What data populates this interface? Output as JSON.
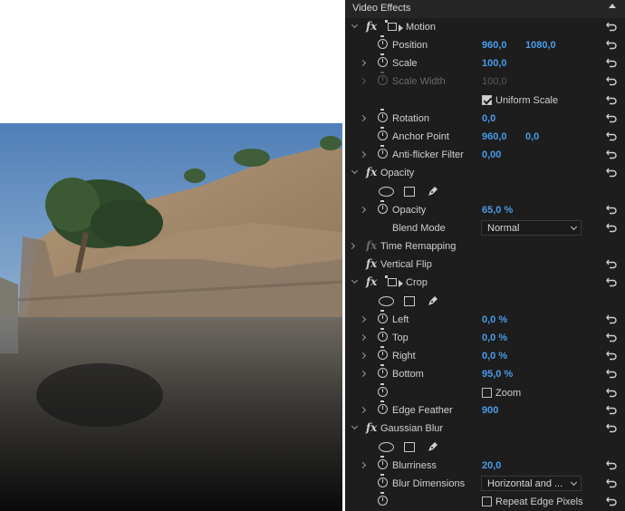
{
  "panel": {
    "title": "Video Effects",
    "motion": {
      "name": "Motion",
      "position": {
        "label": "Position",
        "x": "960,0",
        "y": "1080,0"
      },
      "scale": {
        "label": "Scale",
        "value": "100,0"
      },
      "scale_width": {
        "label": "Scale Width",
        "value": "100,0"
      },
      "uniform_scale": {
        "label": "Uniform Scale",
        "checked": true
      },
      "rotation": {
        "label": "Rotation",
        "value": "0,0"
      },
      "anchor_point": {
        "label": "Anchor Point",
        "x": "960,0",
        "y": "0,0"
      },
      "anti_flicker": {
        "label": "Anti-flicker Filter",
        "value": "0,00"
      }
    },
    "opacity": {
      "name": "Opacity",
      "opacity": {
        "label": "Opacity",
        "value": "65,0 %"
      },
      "blend_mode": {
        "label": "Blend Mode",
        "value": "Normal"
      }
    },
    "time_remapping": {
      "name": "Time Remapping"
    },
    "vertical_flip": {
      "name": "Vertical Flip"
    },
    "crop": {
      "name": "Crop",
      "left": {
        "label": "Left",
        "value": "0,0 %"
      },
      "top": {
        "label": "Top",
        "value": "0,0 %"
      },
      "right": {
        "label": "Right",
        "value": "0,0 %"
      },
      "bottom": {
        "label": "Bottom",
        "value": "95,0 %"
      },
      "zoom": {
        "label": "Zoom",
        "checked": false
      },
      "edge_feather": {
        "label": "Edge Feather",
        "value": "900"
      }
    },
    "gaussian_blur": {
      "name": "Gaussian Blur",
      "blurriness": {
        "label": "Blurriness",
        "value": "20,0"
      },
      "blur_dimensions": {
        "label": "Blur Dimensions",
        "value": "Horizontal and ..."
      },
      "repeat_edge": {
        "label": "Repeat Edge Pixels",
        "checked": false
      }
    }
  },
  "colors": {
    "panel_bg": "#1d1d1d",
    "header_bg": "#262626",
    "value_blue": "#4a9ce8",
    "sky": "#5b86b8"
  }
}
